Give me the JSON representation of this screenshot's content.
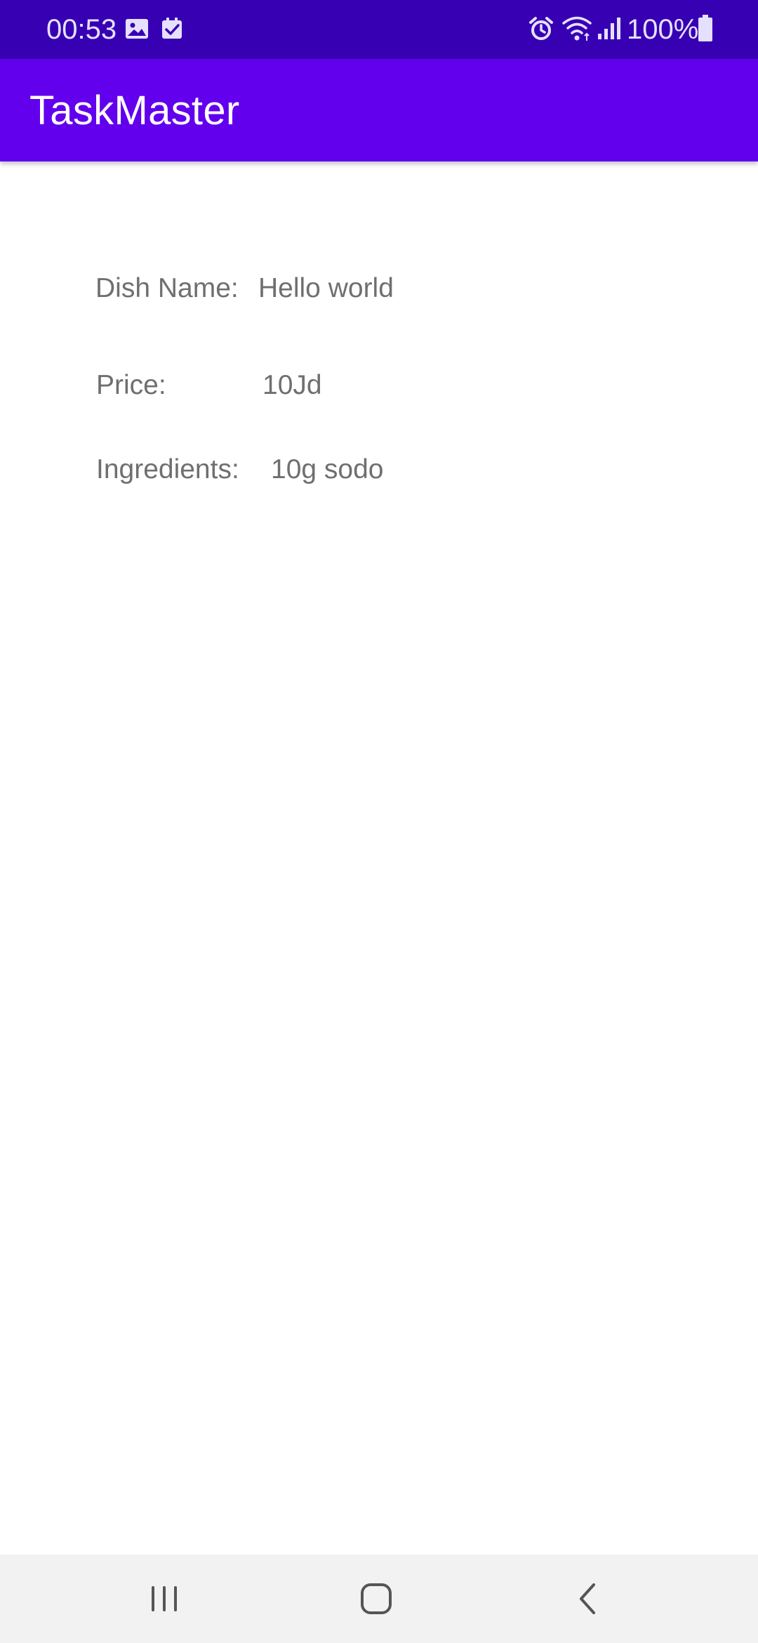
{
  "status_bar": {
    "time": "00:53",
    "battery_percent": "100%",
    "icons": [
      "gallery-icon",
      "task-check-icon",
      "alarm-icon",
      "wifi-icon",
      "signal-icon",
      "battery-icon"
    ]
  },
  "app_bar": {
    "title": "TaskMaster"
  },
  "dish": {
    "name_label": "Dish Name:",
    "name_value": "Hello world",
    "price_label": "Price:",
    "price_value": "10Jd",
    "ingredients_label": "Ingredients:",
    "ingredients_value": "10g sodo"
  },
  "nav_bar": {
    "buttons": [
      "recents-icon",
      "home-icon",
      "back-icon"
    ]
  },
  "colors": {
    "status_bar": "#3700b3",
    "app_bar": "#6200ee",
    "text_secondary": "#6f6f6f",
    "nav_bar": "#f2f2f2"
  }
}
